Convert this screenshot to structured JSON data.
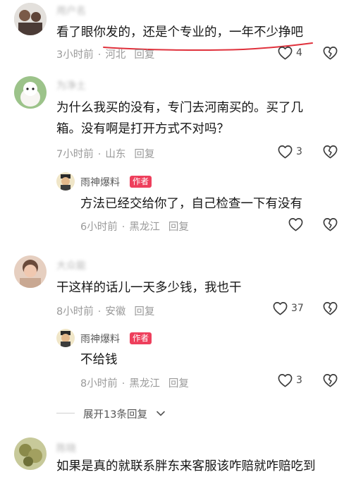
{
  "comments": [
    {
      "username": "用户名",
      "content": "看了眼你发的，还是个专业的，一年不少挣吧",
      "time": "3小时前",
      "location": "河北",
      "reply_label": "回复",
      "likes": "4"
    },
    {
      "username": "为净土",
      "content_lines": [
        "为什么我买的没有，专门去河南买的。买了几",
        "箱。没有啊是打开方式不对吗？"
      ],
      "time": "7小时前",
      "location": "山东",
      "reply_label": "回复",
      "likes": "3"
    },
    {
      "username": "大众能",
      "content": "干这样的话儿一天多少钱，我也干",
      "time": "8小时前",
      "location": "安徽",
      "reply_label": "回复",
      "likes": "37"
    },
    {
      "username": "陈晓",
      "content": "如果是真的就联系胖东来客服该咋赔就咋赔吃到"
    }
  ],
  "replies": [
    {
      "username": "雨神爆料",
      "author_tag": "作者",
      "content": "方法已经交给你了，自己检查一下有没有",
      "time": "6小时前",
      "location": "黑龙江",
      "reply_label": "回复"
    },
    {
      "username": "雨神爆料",
      "author_tag": "作者",
      "content": "不给钱",
      "time": "8小时前",
      "location": "黑龙江",
      "reply_label": "回复",
      "likes": "3"
    }
  ],
  "expand_replies": "展开13条回复",
  "colors": {
    "author_tag": "#ee3f5c",
    "highlight_underline": "#e0313c",
    "meta": "#9a9a9a"
  },
  "icons": [
    "heart-icon",
    "heartbreak-icon",
    "chevron-down-icon"
  ]
}
